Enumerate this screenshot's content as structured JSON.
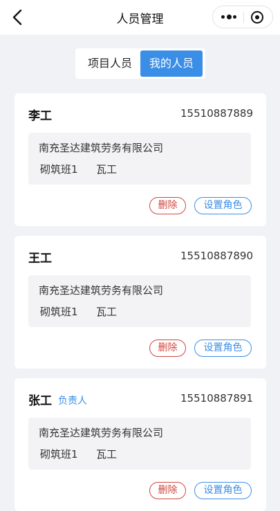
{
  "header": {
    "title": "人员管理",
    "back_icon": "chevron-left-icon",
    "more_icon": "more-dots-icon",
    "close_icon": "target-circle-icon"
  },
  "tabs": [
    {
      "label": "项目人员",
      "active": false
    },
    {
      "label": "我的人员",
      "active": true
    }
  ],
  "accent_color": "#3b8ee6",
  "danger_color": "#d0453e",
  "people": [
    {
      "name": "李工",
      "tag": "",
      "phone": "15510887889",
      "company": "南充圣达建筑劳务有限公司",
      "team": "砌筑班1",
      "trade": "瓦工",
      "delete_label": "删除",
      "role_label": "设置角色"
    },
    {
      "name": "王工",
      "tag": "",
      "phone": "15510887890",
      "company": "南充圣达建筑劳务有限公司",
      "team": "砌筑班1",
      "trade": "瓦工",
      "delete_label": "删除",
      "role_label": "设置角色"
    },
    {
      "name": "张工",
      "tag": "负责人",
      "phone": "15510887891",
      "company": "南充圣达建筑劳务有限公司",
      "team": "砌筑班1",
      "trade": "瓦工",
      "delete_label": "删除",
      "role_label": "设置角色"
    }
  ]
}
